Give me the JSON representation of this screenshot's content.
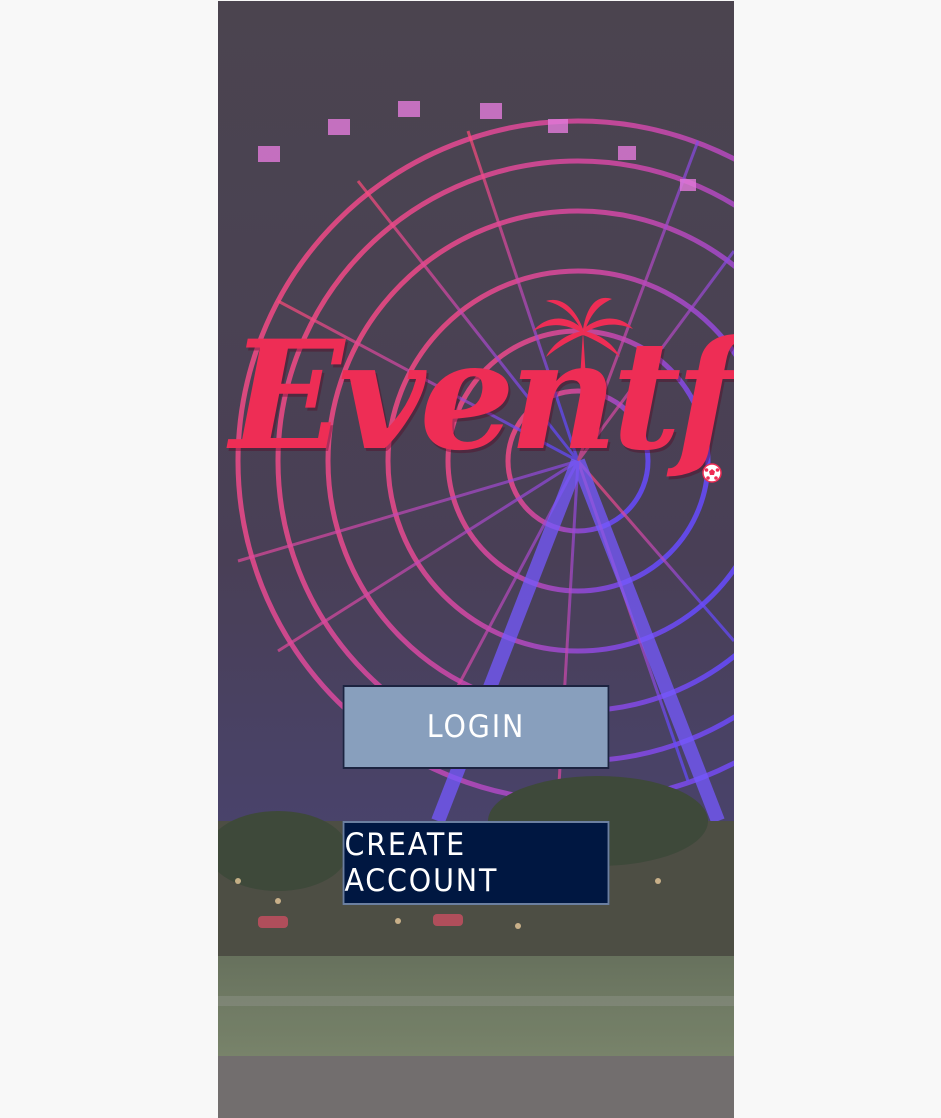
{
  "app": {
    "logo_text": "Eventful"
  },
  "buttons": {
    "login_label": "LOGIN",
    "create_account_label": "CREATE ACCOUNT"
  },
  "icons": {
    "palm": "palm-tree-icon",
    "badge": "soccer-ball-icon"
  },
  "colors": {
    "logo": "#ee2d55",
    "login_button": "#889fbd",
    "create_button": "#001741",
    "page_background": "#f8f8f8"
  }
}
